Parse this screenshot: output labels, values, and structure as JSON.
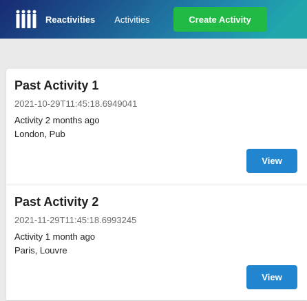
{
  "navbar": {
    "brand_label": "Reactivities",
    "logo_icon": "people-group-icon",
    "activities_label": "Activities",
    "create_label": "Create Activity",
    "colors": {
      "gradient_start": "#182a73",
      "gradient_mid": "#218aae",
      "gradient_end": "#20a7ac",
      "create_button": "#21ba45"
    }
  },
  "activities": [
    {
      "title": "Past Activity 1",
      "date": "2021-10-29T11:45:18.6949041",
      "description": "Activity 2 months ago",
      "venue": "London, Pub",
      "view_label": "View"
    },
    {
      "title": "Past Activity 2",
      "date": "2021-11-29T11:45:18.6993245",
      "description": "Activity 1 month ago",
      "venue": "Paris, Louvre",
      "view_label": "View"
    }
  ],
  "colors": {
    "view_button": "#2185d0",
    "page_background": "#eaeaea"
  }
}
